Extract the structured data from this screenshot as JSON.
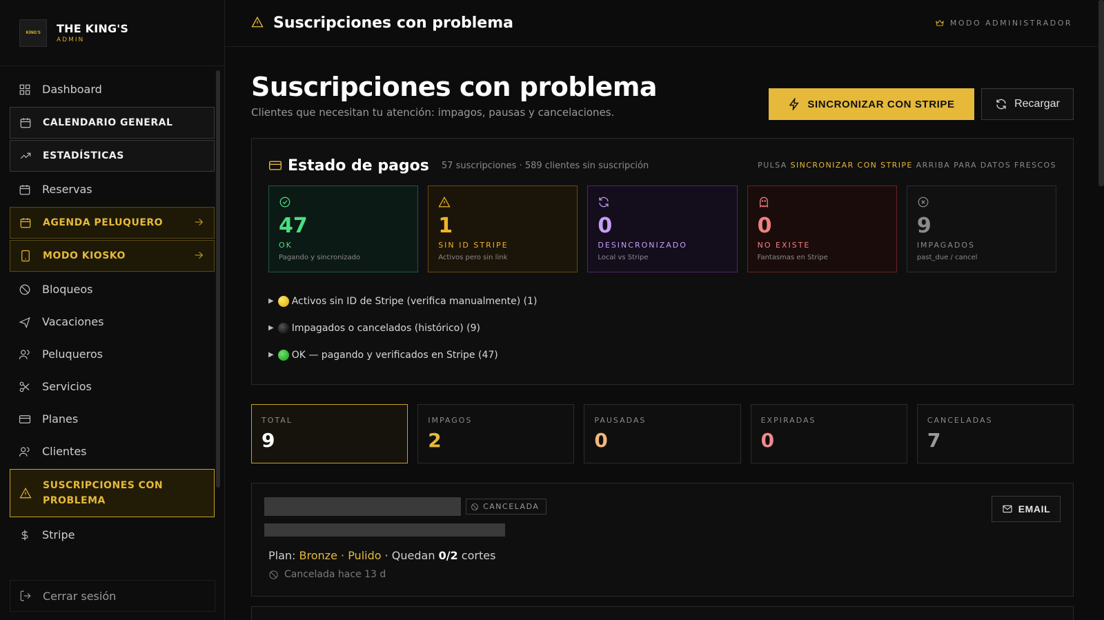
{
  "brand": {
    "name": "THE KING'S",
    "sub": "ADMIN",
    "logo_text": "KING'S"
  },
  "sidebar": {
    "items": [
      {
        "label": "Dashboard"
      },
      {
        "label": "CALENDARIO GENERAL"
      },
      {
        "label": "ESTADÍSTICAS"
      },
      {
        "label": "Reservas"
      },
      {
        "label": "AGENDA PELUQUERO"
      },
      {
        "label": "MODO KIOSKO"
      },
      {
        "label": "Bloqueos"
      },
      {
        "label": "Vacaciones"
      },
      {
        "label": "Peluqueros"
      },
      {
        "label": "Servicios"
      },
      {
        "label": "Planes"
      },
      {
        "label": "Clientes"
      },
      {
        "label": "SUSCRIPCIONES CON PROBLEMA"
      },
      {
        "label": "Stripe"
      }
    ],
    "logout": "Cerrar sesión"
  },
  "topbar": {
    "title": "Suscripciones con problema",
    "admin_mode": "MODO ADMINISTRADOR"
  },
  "page": {
    "title": "Suscripciones con problema",
    "subtitle": "Clientes que necesitan tu atención: impagos, pausas y cancelaciones.",
    "sync_button": "SINCRONIZAR CON STRIPE",
    "reload_button": "Recargar"
  },
  "payments": {
    "title": "Estado de pagos",
    "meta": "57 suscripciones · 589 clientes sin suscripción",
    "hint_prefix": "PULSA",
    "hint_highlight": "SINCRONIZAR CON STRIPE",
    "hint_suffix": "ARRIBA PARA DATOS FRESCOS",
    "cards": [
      {
        "value": "47",
        "label": "OK",
        "desc": "Pagando y sincronizado",
        "icon": "check-circle-icon"
      },
      {
        "value": "1",
        "label": "SIN ID STRIPE",
        "desc": "Activos pero sin link",
        "icon": "warning-icon"
      },
      {
        "value": "0",
        "label": "DESINCRONIZADO",
        "desc": "Local vs Stripe",
        "icon": "refresh-icon"
      },
      {
        "value": "0",
        "label": "NO EXISTE",
        "desc": "Fantasmas en Stripe",
        "icon": "ghost-icon"
      },
      {
        "value": "9",
        "label": "IMPAGADOS",
        "desc": "past_due / cancel",
        "icon": "x-circle-icon"
      }
    ],
    "details": [
      {
        "text": "Activos sin ID de Stripe (verifica manualmente) (1)",
        "dot": "yellow"
      },
      {
        "text": "Impagados o cancelados (histórico) (9)",
        "dot": "black"
      },
      {
        "text": "OK — pagando y verificados en Stripe (47)",
        "dot": "green"
      }
    ]
  },
  "kpis": [
    {
      "label": "TOTAL",
      "value": "9"
    },
    {
      "label": "IMPAGOS",
      "value": "2"
    },
    {
      "label": "PAUSADAS",
      "value": "0"
    },
    {
      "label": "EXPIRADAS",
      "value": "0"
    },
    {
      "label": "CANCELADAS",
      "value": "7"
    }
  ],
  "subscription": {
    "badge": "CANCELADA",
    "plan_prefix": "Plan:",
    "plan_name": "Bronze",
    "sep1": "·",
    "plan_variant": "Pulido",
    "sep2": "· Quedan",
    "remaining": "0/2",
    "cuts": "cortes",
    "cancel_note": "Cancelada hace 13 d",
    "email_button": "EMAIL"
  },
  "colors": {
    "accent": "#e6b93b",
    "ok": "#4ade80",
    "warn": "#f0b429",
    "desync": "#c4a0f5",
    "ghost": "#f08080",
    "bg": "#0c0c0c"
  }
}
